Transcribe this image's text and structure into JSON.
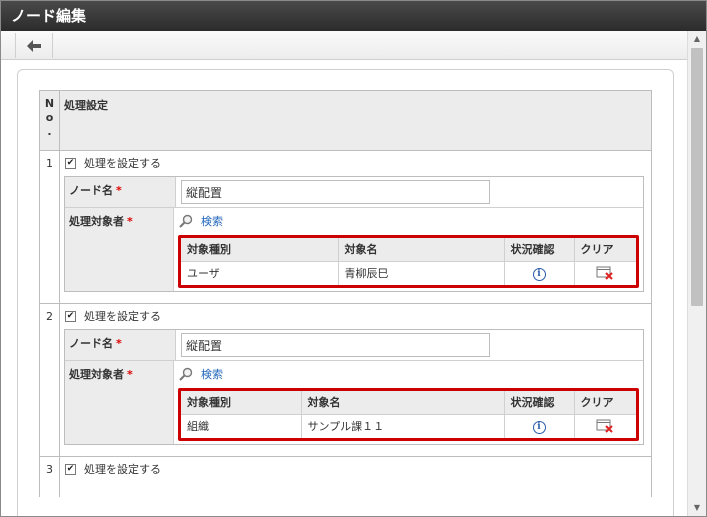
{
  "window": {
    "title": "ノード編集"
  },
  "toolbar": {
    "back_icon": "arrow-left-icon"
  },
  "grid": {
    "col_no": "No.",
    "col_setting": "処理設定"
  },
  "rows": [
    {
      "num": "1",
      "check_label": "処理を設定する",
      "checked": true,
      "node_name_label": "ノード名",
      "node_name_value": "縦配置",
      "target_label": "処理対象者",
      "search_label": "検索",
      "table_headers": [
        "対象種別",
        "対象名",
        "状況確認",
        "クリア"
      ],
      "table_row": {
        "type": "ユーザ",
        "name": "青柳辰巳"
      }
    },
    {
      "num": "2",
      "check_label": "処理を設定する",
      "checked": true,
      "node_name_label": "ノード名",
      "node_name_value": "縦配置",
      "target_label": "処理対象者",
      "search_label": "検索",
      "table_headers": [
        "対象種別",
        "対象名",
        "状況確認",
        "クリア"
      ],
      "table_row": {
        "type": "組織",
        "name": "サンプル課１１"
      }
    },
    {
      "num": "3",
      "check_label": "処理を設定する",
      "checked": true
    }
  ],
  "required_mark": "*",
  "colors": {
    "highlight": "#cc0000",
    "link": "#2266bb",
    "titlebar": "#333333"
  }
}
